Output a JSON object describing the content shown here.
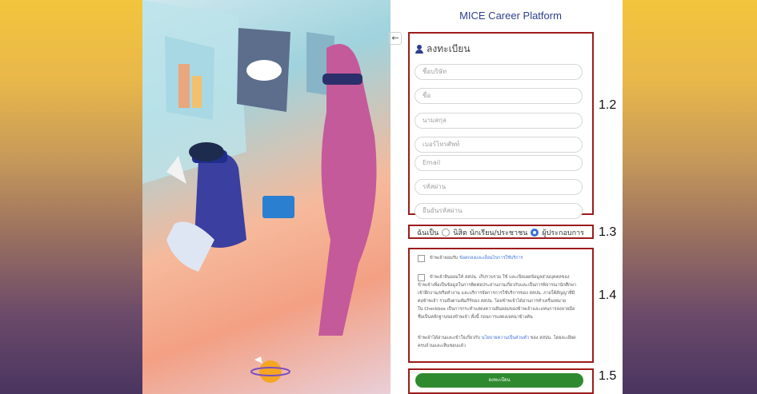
{
  "app": {
    "title": "MICE Career Platform"
  },
  "form": {
    "back_icon": "arrow-left-icon",
    "heading_icon": "user-icon",
    "heading": "ลงทะเบียน",
    "fields": [
      {
        "placeholder": "ชื่อบริษัท"
      },
      {
        "placeholder": "ชื่อ"
      },
      {
        "placeholder": "นามสกุล"
      },
      {
        "placeholder": "เบอร์โทรศัพท์"
      },
      {
        "placeholder": "Email"
      },
      {
        "placeholder": "รหัสผ่าน"
      },
      {
        "placeholder": "ยืนยันรหัสผ่าน"
      }
    ],
    "role": {
      "prefix": "ฉันเป็น",
      "options": [
        {
          "label": "นิสิต นักเรียน/ประชาชน",
          "selected": false
        },
        {
          "label": "ผู้ประกอบการ",
          "selected": true
        }
      ]
    },
    "consent1": {
      "text": "ข้าพเจ้ายอมรับ",
      "link": "ข้อตกลงและเงื่อนไขการใช้บริการ"
    },
    "consent2": {
      "lines": [
        "ข้าพเจ้ายินยอมให้ สสปน. เก็บรวบรวม ใช้ และเปิดเผยข้อมูลส่วนบุคคลของ",
        "ข้าพเจ้าเพื่อเป็นข้อมูลในการติดต่อประสานงานเกี่ยวกับและเป็นการพิจารณานักศึกษา",
        "เข้าฝึกงาน/หรือทำงาน และบริการจัดการการใช้บริการของ สสปน. ภายใต้สัญญาที่มี",
        "ต่อข้าพเจ้า รวมถึงตามคัมภีร์ของ สสปน. โดยข้าพเจ้าได้อ่านการทำเครื่องหมาย",
        "ใน Checkbox เป็นการกระทำแสดงความยินยอมของข้าพเจ้าและแทนการลงลายมือ",
        "ชื่อเป็นหลักฐานของข้าพเจ้า ทั้งนี้ ก่อนการแสดงเจตนาข้างต้น"
      ]
    },
    "consent3": {
      "prefix": "ข้าพเจ้าได้อ่านและเข้าใจเกี่ยวกับ",
      "link": "นโยบายความเป็นส่วนตัว",
      "suffix": "ของ สสปน. โดยละเอียด",
      "line2": "ครบถ้วนและเห็นชอบแล้ว"
    },
    "submit_label": "ลงทะเบียน"
  },
  "annotations": [
    "1.2",
    "1.3",
    "1.4",
    "1.5"
  ],
  "colors": {
    "title": "#2e3f8f",
    "submit": "#2f8a2f",
    "highlight_box": "#9e1b1b",
    "radio_on": "#3a6fd8"
  }
}
